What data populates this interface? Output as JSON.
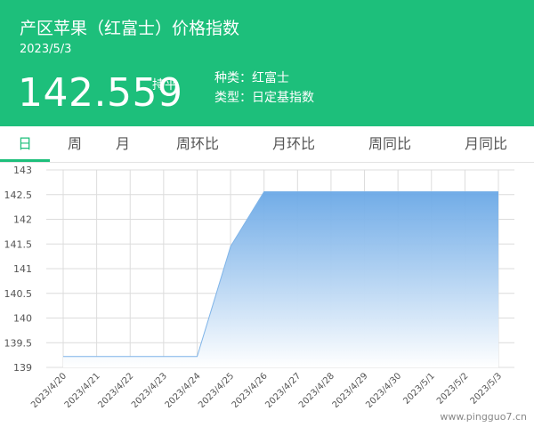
{
  "header": {
    "title": "产区苹果（红富士）价格指数",
    "date": "2023/5/3",
    "price": "142.559",
    "trend": "持平",
    "meta_variety": "种类：红富士",
    "meta_type": "类型：日定基指数",
    "background_color": "#1dbf7b"
  },
  "tabs": [
    {
      "label": "日",
      "active": true
    },
    {
      "label": "周",
      "active": false
    },
    {
      "label": "月",
      "active": false
    },
    {
      "label": "周环比",
      "active": false
    },
    {
      "label": "月环比",
      "active": false
    },
    {
      "label": "周同比",
      "active": false
    },
    {
      "label": "月同比",
      "active": false
    }
  ],
  "watermark": "www.pingguo7.cn",
  "chart_data": {
    "type": "area",
    "x": [
      "2023/4/20",
      "2023/4/21",
      "2023/4/22",
      "2023/4/23",
      "2023/4/24",
      "2023/4/25",
      "2023/4/26",
      "2023/4/27",
      "2023/4/28",
      "2023/4/29",
      "2023/4/30",
      "2023/5/1",
      "2023/5/2",
      "2023/5/3"
    ],
    "series": [
      {
        "values": [
          139.22,
          139.22,
          139.22,
          139.22,
          139.22,
          141.45,
          142.559,
          142.559,
          142.559,
          142.559,
          142.559,
          142.559,
          142.559,
          142.559
        ]
      }
    ],
    "y_ticks": [
      "139",
      "139.5",
      "140",
      "140.5",
      "141",
      "141.5",
      "142",
      "142.5",
      "143"
    ],
    "ylim": [
      139,
      143
    ],
    "grid": true,
    "line_color": "#7fb4e8",
    "fill_color_top": "#6aa8e6",
    "fill_color_bottom": "#ffffff"
  }
}
